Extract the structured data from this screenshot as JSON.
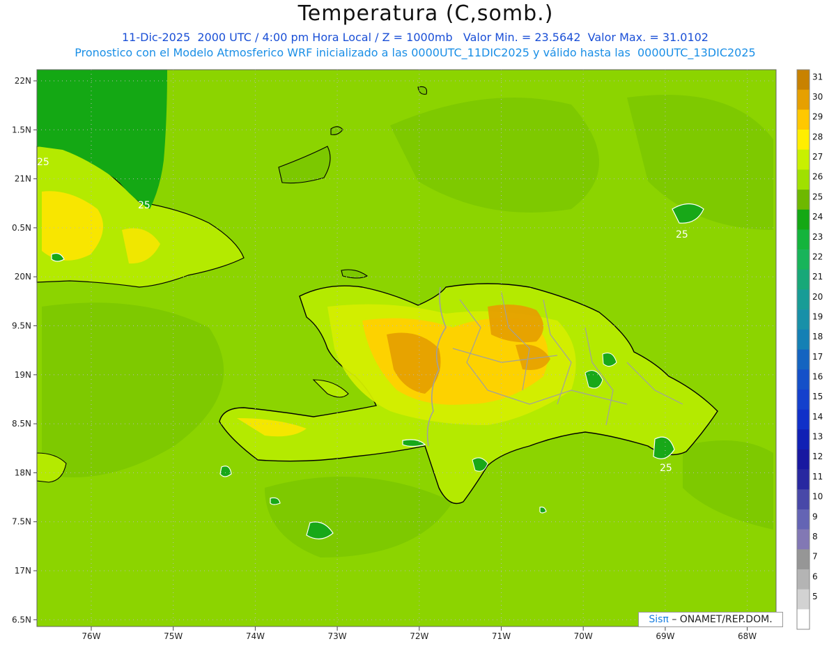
{
  "header": {
    "title": "Temperatura (C,somb.)",
    "line1": "11-Dic-2025  2000 UTC / 4:00 pm Hora Local / Z = 1000mb   Valor Min. = 23.5642  Valor Max. = 31.0102",
    "line2": "Pronostico con el Modelo Atmosferico WRF inicializado a las 0000UTC_11DIC2025 y válido hasta las  0000UTC_13DIC2025"
  },
  "axes": {
    "lat_labels": [
      "22N",
      "1.5N",
      "21N",
      "0.5N",
      "20N",
      "9.5N",
      "19N",
      "8.5N",
      "18N",
      "7.5N",
      "17N",
      "6.5N"
    ],
    "lon_labels": [
      "76W",
      "75W",
      "74W",
      "73W",
      "72W",
      "71W",
      "70W",
      "69W",
      "68W"
    ]
  },
  "colorbar": {
    "labels": [
      "31",
      "30",
      "29",
      "28",
      "27",
      "26",
      "25",
      "24",
      "23",
      "22",
      "21",
      "20",
      "19",
      "18",
      "17",
      "16",
      "15",
      "14",
      "13",
      "12",
      "11",
      "10",
      "9",
      "8",
      "7",
      "6",
      "5"
    ],
    "colors": [
      "#c88200",
      "#e6a000",
      "#ffc800",
      "#ffee00",
      "#c8f000",
      "#a0e000",
      "#6eb800",
      "#14a814",
      "#14b43c",
      "#18b45a",
      "#18a878",
      "#189c96",
      "#1890a8",
      "#1480b4",
      "#1464c0",
      "#1450c8",
      "#1440cc",
      "#1030c8",
      "#1020b4",
      "#1818a0",
      "#2828a0",
      "#4848a8",
      "#6464b4",
      "#8278b4",
      "#969696",
      "#b4b4b4",
      "#d2d2d2",
      "#ffffff"
    ]
  },
  "map": {
    "field_color": "#8cd400",
    "contour_label": "25",
    "colors": {
      "land_low": "#b4ea00",
      "land_mid": "#d4ee00",
      "warm": "#ffd000",
      "hot": "#e6a000",
      "cool_sea": "#7cc800",
      "cool_land": "#18a818",
      "coast": "#000000",
      "border": "#a0a0a0",
      "contour": "#ffffff"
    }
  },
  "credit": {
    "sis": "Sisπ",
    "org": "– ONAMET/REP.DOM."
  }
}
